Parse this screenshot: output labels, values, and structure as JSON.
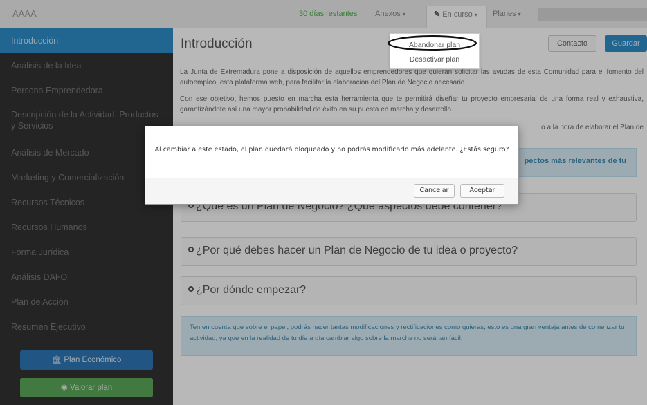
{
  "navbar": {
    "brand": "AAAA",
    "days_remaining": "30 días restantes",
    "menu_anexos": "Anexos",
    "menu_en_curso": "En curso",
    "menu_planes": "Planes",
    "caret": "▾",
    "en_curso_icon": "✎"
  },
  "dropdown": {
    "abandon": "Abandonar plan",
    "deactivate": "Desactivar plan"
  },
  "sidebar": {
    "items": [
      "Introducción",
      "Análisis de la Idea",
      "Persona Emprendedora",
      "Descripción de la Actividad. Productos y Servicios",
      "Análisis de Mercado",
      "Marketing y Comercialización",
      "Recursos Técnicos",
      "Recursos Humanos",
      "Forma Jurídica",
      "Análisis DAFO",
      "Plan de Acción",
      "Resumen Ejecutivo"
    ],
    "btn_economic": "Plan Económico",
    "btn_valorar": "Valorar plan"
  },
  "main": {
    "title": "Introducción",
    "btn_contacto": "Contacto",
    "btn_guardar": "Guardar",
    "p1": "La Junta de Extremadura pone a disposición de aquellos emprendedores que quieran solicitar las ayudas de esta Comunidad para el fomento del autoempleo, esta plataforma web, para facilitar la elaboración del Plan de Negocio necesario.",
    "p2": "Con ese objetivo, hemos puesto en marcha esta herramienta que te permitirá diseñar tu proyecto empresarial de una forma real y exhaustiva, garantizándote así una mayor probabilidad de éxito en su puesta en marcha y desarrollo.",
    "p3": "o a la hora de elaborar el Plan de",
    "info_fragment": "pectos más relevantes de tu",
    "q1": "¿Qué es un Plan de Negocio? ¿Qué aspectos debe contener?",
    "q2": "¿Por qué debes hacer un Plan de Negocio de tu idea o proyecto?",
    "q3": "¿Por dónde empezar?",
    "note": "Ten en cuenta que sobre el papel, podrás hacer tantas modificaciones y rectificaciones como quieras, esto es una gran ventaja antes de comenzar tu actividad, ya que en la realidad de tu día a día cambiar algo sobre la marcha no será tan fácil."
  },
  "modal": {
    "message": "Al cambiar a este estado, el plan quedará bloqueado y no podrás modificarlo más adelante. ¿Estás seguro?",
    "cancel": "Cancelar",
    "accept": "Aceptar"
  }
}
